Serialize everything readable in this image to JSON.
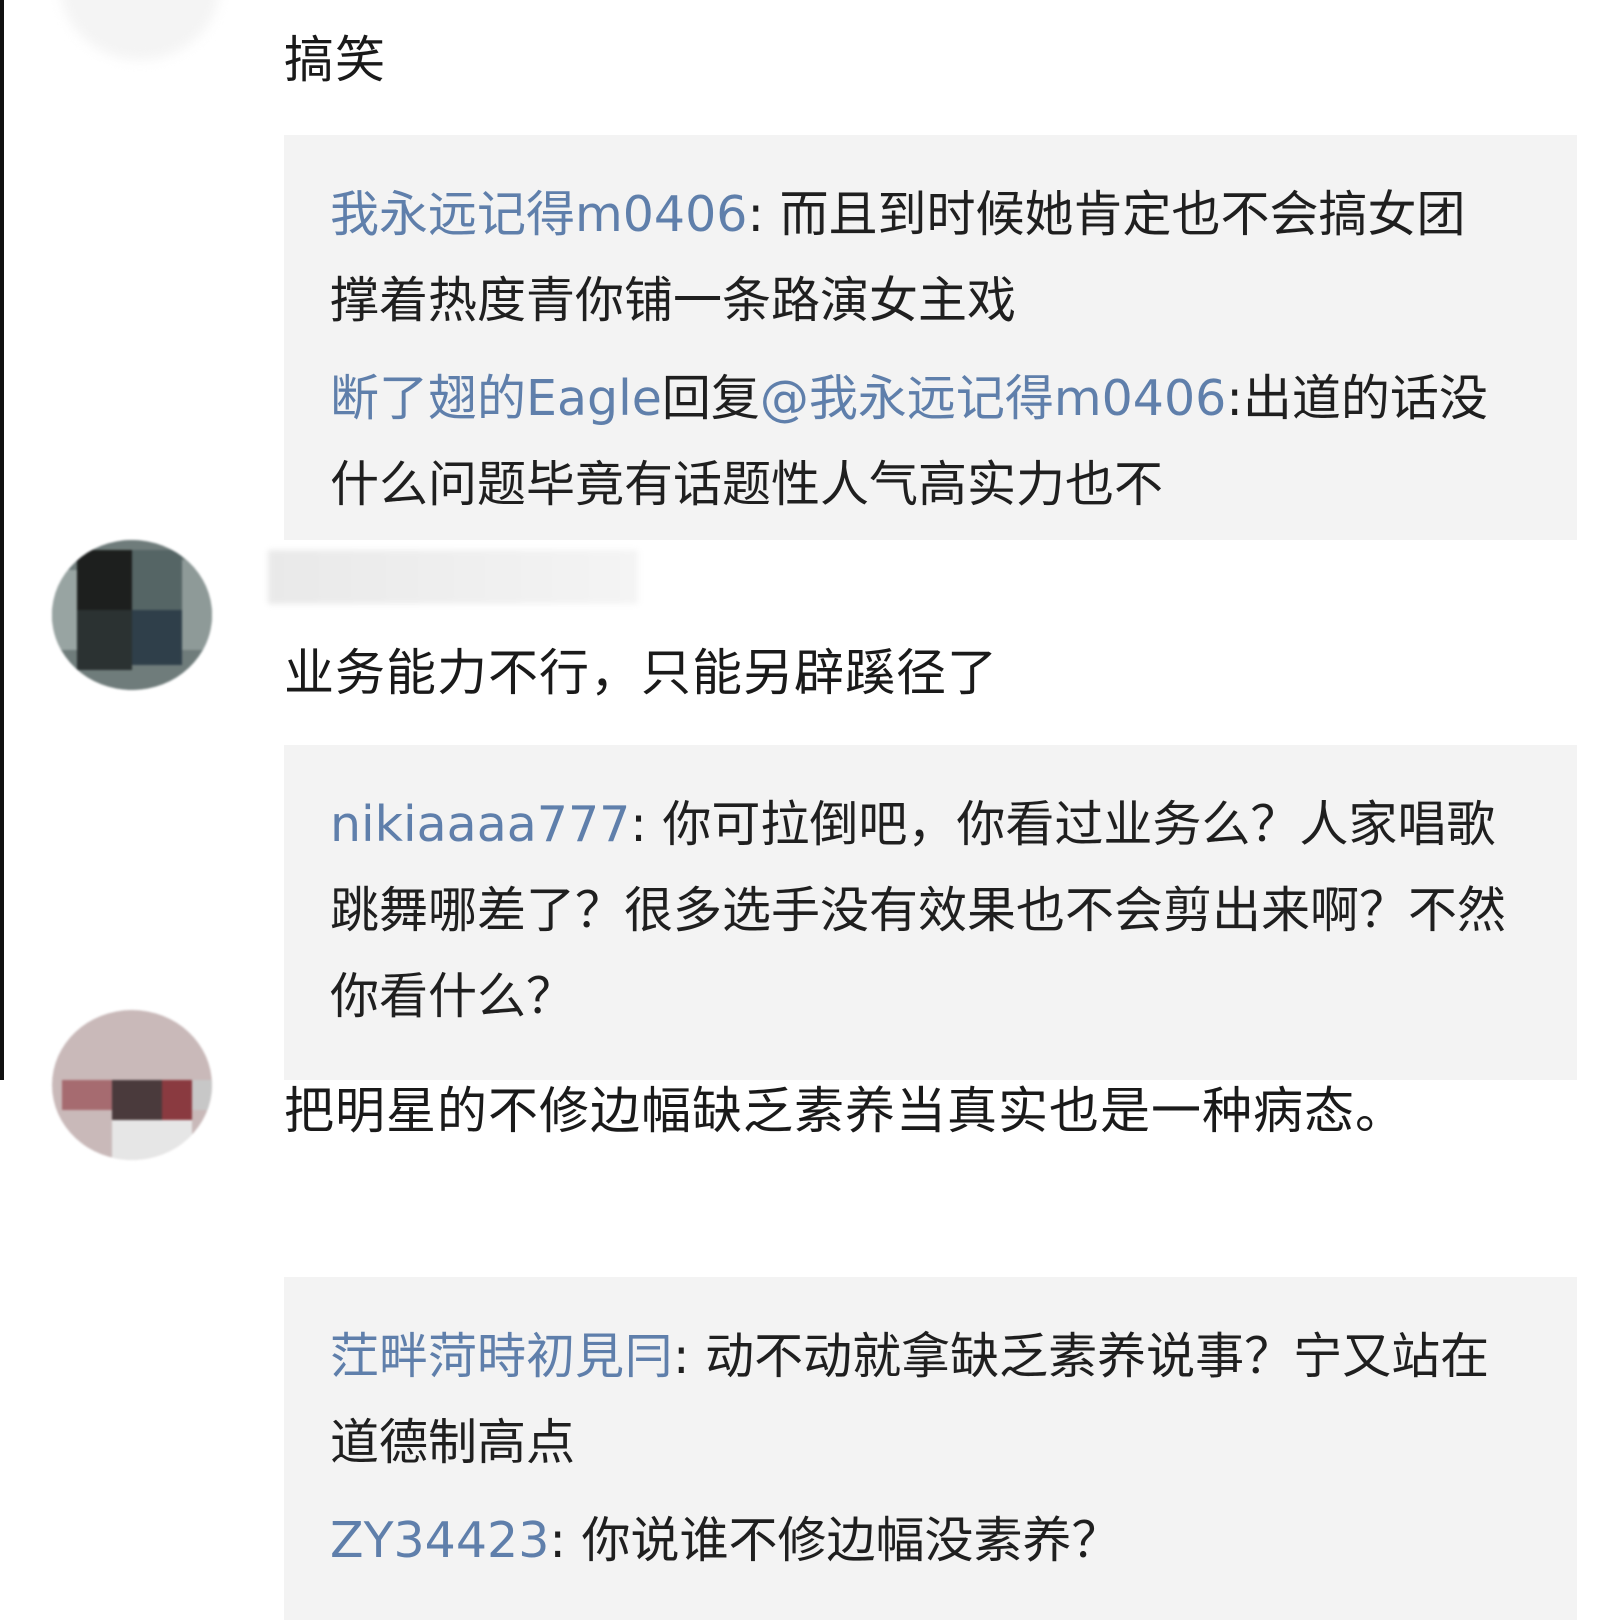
{
  "comments": [
    {
      "text": "搞笑",
      "replies": [
        {
          "user": "我永远记得m0406",
          "sep": ": ",
          "text": "而且到时候她肯定也不会搞女团  撑着热度青你铺一条路演女主戏"
        },
        {
          "user": "断了翅的Eagle",
          "reply_word": "回复",
          "mention": "@我永远记得m0406",
          "sep": ":",
          "text": "出道的话没什么问题毕竟有话题性人气高实力也不"
        }
      ]
    },
    {
      "text": "业务能力不行，只能另辟蹊径了",
      "replies": [
        {
          "user": "nikiaaaa777",
          "sep": ": ",
          "text": "你可拉倒吧，你看过业务么？人家唱歌跳舞哪差了？很多选手没有效果也不会剪出来啊？不然你看什么？"
        }
      ]
    },
    {
      "text": "把明星的不修边幅缺乏素养当真实也是一种病态。",
      "replies": [
        {
          "user": "茳畔菏時初見冃",
          "sep": ": ",
          "text": "动不动就拿缺乏素养说事？宁又站在道德制高点"
        },
        {
          "user": "ZY34423",
          "sep": ": ",
          "text": "你说谁不修边幅没素养？"
        }
      ]
    }
  ],
  "colors": {
    "username": "#5f7fab",
    "text": "#1a1a1a",
    "reply_bg": "#f3f3f3"
  }
}
